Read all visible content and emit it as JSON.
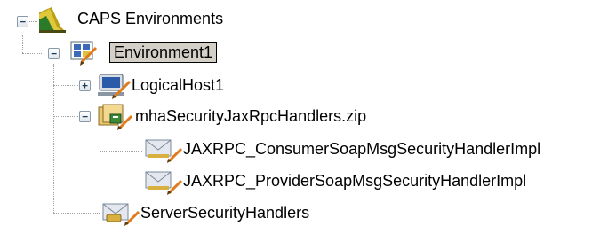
{
  "tree": {
    "root": {
      "label": "CAPS Environments",
      "expanded": true,
      "icon": "caps-root-icon"
    },
    "environment": {
      "label": "Environment1",
      "expanded": true,
      "selected": true,
      "icon": "environment-icon"
    },
    "logical_host": {
      "label": "LogicalHost1",
      "expanded": false,
      "icon": "logical-host-icon"
    },
    "zip": {
      "label": "mhaSecurityJaxRpcHandlers.zip",
      "expanded": true,
      "icon": "archive-icon"
    },
    "consumer_handler": {
      "label": "JAXRPC_ConsumerSoapMsgSecurityHandlerImpl",
      "icon": "envelope-icon"
    },
    "provider_handler": {
      "label": "JAXRPC_ProviderSoapMsgSecurityHandlerImpl",
      "icon": "envelope-icon"
    },
    "server_handlers": {
      "label": "ServerSecurityHandlers",
      "icon": "envelope-icon"
    }
  },
  "toggle_glyphs": {
    "expanded": "−",
    "collapsed": "+"
  },
  "colors": {
    "selection": "#d4d0c8",
    "connector": "#a0a0a0",
    "pencil": "#e07a1a"
  }
}
